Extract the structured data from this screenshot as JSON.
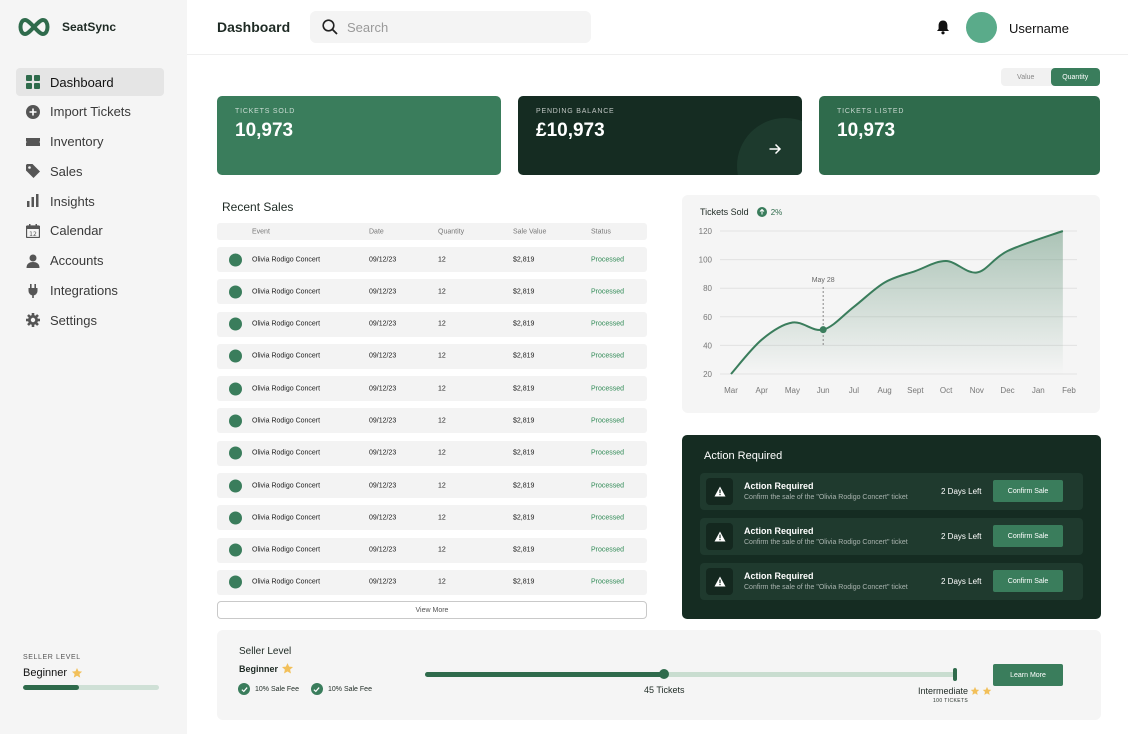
{
  "app": {
    "name": "SeatSync",
    "brand_color": "#3a7d5c",
    "dark_color": "#152c22"
  },
  "sidebar": {
    "items": [
      {
        "label": "Dashboard",
        "icon": "grid-icon",
        "active": true
      },
      {
        "label": "Import Tickets",
        "icon": "plus-circle-icon"
      },
      {
        "label": "Inventory",
        "icon": "ticket-icon"
      },
      {
        "label": "Sales",
        "icon": "tag-icon"
      },
      {
        "label": "Insights",
        "icon": "bar-chart-icon"
      },
      {
        "label": "Calendar",
        "icon": "calendar-icon"
      },
      {
        "label": "Accounts",
        "icon": "user-icon"
      },
      {
        "label": "Integrations",
        "icon": "plug-icon"
      },
      {
        "label": "Settings",
        "icon": "gear-icon"
      }
    ],
    "seller": {
      "caption": "SELLER LEVEL",
      "level": "Beginner",
      "progress": 0.41
    }
  },
  "header": {
    "title": "Dashboard",
    "search_placeholder": "Search",
    "username": "Username"
  },
  "toggle": {
    "options": [
      "Value",
      "Quantity"
    ],
    "selected": "Quantity"
  },
  "stats": [
    {
      "caption": "TICKETS SOLD",
      "value": "10,973"
    },
    {
      "caption": "PENDING BALANCE",
      "value": "£10,973"
    },
    {
      "caption": "TICKETS LISTED",
      "value": "10,973"
    }
  ],
  "recent_sales": {
    "title": "Recent Sales",
    "columns": [
      "Event",
      "Date",
      "Quantity",
      "Sale Value",
      "Status"
    ],
    "rows": [
      {
        "event": "Olivia Rodigo Concert",
        "date": "09/12/23",
        "quantity": "12",
        "value": "$2,819",
        "status": "Processed"
      },
      {
        "event": "Olivia Rodigo Concert",
        "date": "09/12/23",
        "quantity": "12",
        "value": "$2,819",
        "status": "Processed"
      },
      {
        "event": "Olivia Rodigo Concert",
        "date": "09/12/23",
        "quantity": "12",
        "value": "$2,819",
        "status": "Processed"
      },
      {
        "event": "Olivia Rodigo Concert",
        "date": "09/12/23",
        "quantity": "12",
        "value": "$2,819",
        "status": "Processed"
      },
      {
        "event": "Olivia Rodigo Concert",
        "date": "09/12/23",
        "quantity": "12",
        "value": "$2,819",
        "status": "Processed"
      },
      {
        "event": "Olivia Rodigo Concert",
        "date": "09/12/23",
        "quantity": "12",
        "value": "$2,819",
        "status": "Processed"
      },
      {
        "event": "Olivia Rodigo Concert",
        "date": "09/12/23",
        "quantity": "12",
        "value": "$2,819",
        "status": "Processed"
      },
      {
        "event": "Olivia Rodigo Concert",
        "date": "09/12/23",
        "quantity": "12",
        "value": "$2,819",
        "status": "Processed"
      },
      {
        "event": "Olivia Rodigo Concert",
        "date": "09/12/23",
        "quantity": "12",
        "value": "$2,819",
        "status": "Processed"
      },
      {
        "event": "Olivia Rodigo Concert",
        "date": "09/12/23",
        "quantity": "12",
        "value": "$2,819",
        "status": "Processed"
      },
      {
        "event": "Olivia Rodigo Concert",
        "date": "09/12/23",
        "quantity": "12",
        "value": "$2,819",
        "status": "Processed"
      }
    ],
    "view_more": "View More"
  },
  "chart_data": {
    "type": "area",
    "title": "Tickets Sold",
    "change": "2%",
    "categories": [
      "Mar",
      "Apr",
      "May",
      "Jun",
      "Jul",
      "Aug",
      "Sept",
      "Oct",
      "Nov",
      "Dec",
      "Jan",
      "Feb"
    ],
    "values": [
      20,
      44,
      56,
      51,
      67,
      84,
      92,
      99,
      91,
      106,
      120
    ],
    "x": [
      0,
      1,
      2,
      3,
      4,
      5,
      6,
      7,
      8,
      9,
      10.8
    ],
    "ylim": [
      20,
      120
    ],
    "yticks": [
      20,
      40,
      60,
      80,
      100,
      120
    ],
    "annotation": {
      "label": "May 28",
      "x": 3,
      "value": 51
    },
    "grid": true
  },
  "actions": {
    "title": "Action Required",
    "items": [
      {
        "title": "Action Required",
        "desc": "Confirm the sale of the \"Olivia Rodigo Concert\" ticket",
        "days": "2 Days Left",
        "button": "Confirm Sale"
      },
      {
        "title": "Action Required",
        "desc": "Confirm the sale of the \"Olivia Rodigo Concert\" ticket",
        "days": "2 Days Left",
        "button": "Confirm Sale"
      },
      {
        "title": "Action Required",
        "desc": "Confirm the sale of the \"Olivia Rodigo Concert\" ticket",
        "days": "2 Days Left",
        "button": "Confirm Sale"
      }
    ]
  },
  "seller_level": {
    "title": "Seller Level",
    "level": "Beginner",
    "perks": [
      "10% Sale Fee",
      "10% Sale Fee"
    ],
    "tickets": "45 Tickets",
    "next_level": "Intermediate",
    "next_tickets": "100 TICKETS",
    "progress": 0.45,
    "button": "Learn More"
  }
}
